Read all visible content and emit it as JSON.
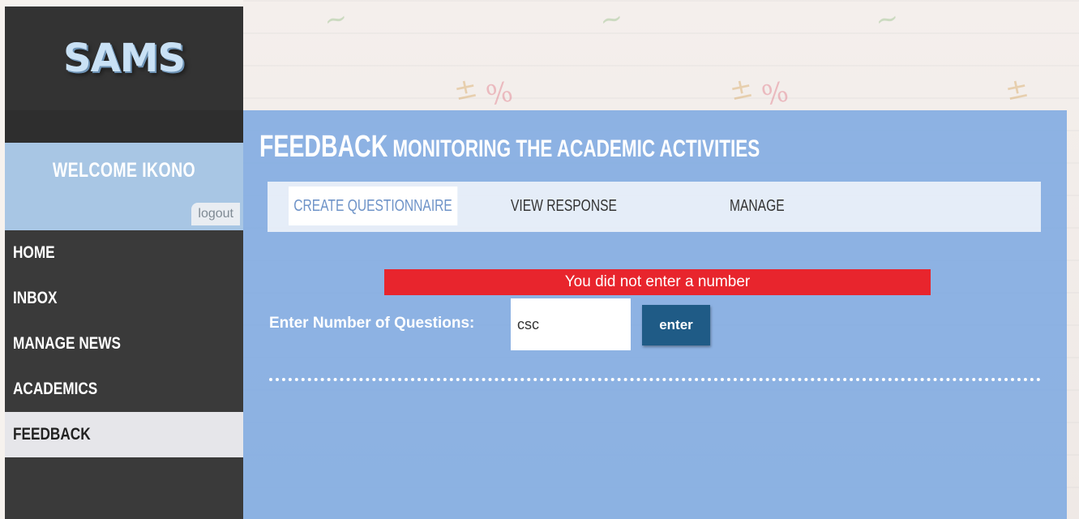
{
  "sidebar": {
    "logo": "SAMS",
    "welcome": "WELCOME IKONO",
    "logout_label": "logout",
    "nav": [
      "HOME",
      "INBOX",
      "MANAGE NEWS",
      "ACADEMICS",
      "FEEDBACK"
    ]
  },
  "main": {
    "title": "FEEDBACK",
    "subtitle": "MONITORING THE ACADEMIC ACTIVITIES",
    "tabs": [
      "CREATE QUESTIONNAIRE",
      "VIEW RESPONSE",
      "MANAGE"
    ],
    "error": "You did not enter a number",
    "question_label": "Enter Number of Questions:",
    "question_value": "csc",
    "enter_label": "enter"
  },
  "colors": {
    "panel": "#7eaae1",
    "error": "#e8252d",
    "enter_button": "#1f5b86",
    "sidebar": "#3a3a3a"
  }
}
